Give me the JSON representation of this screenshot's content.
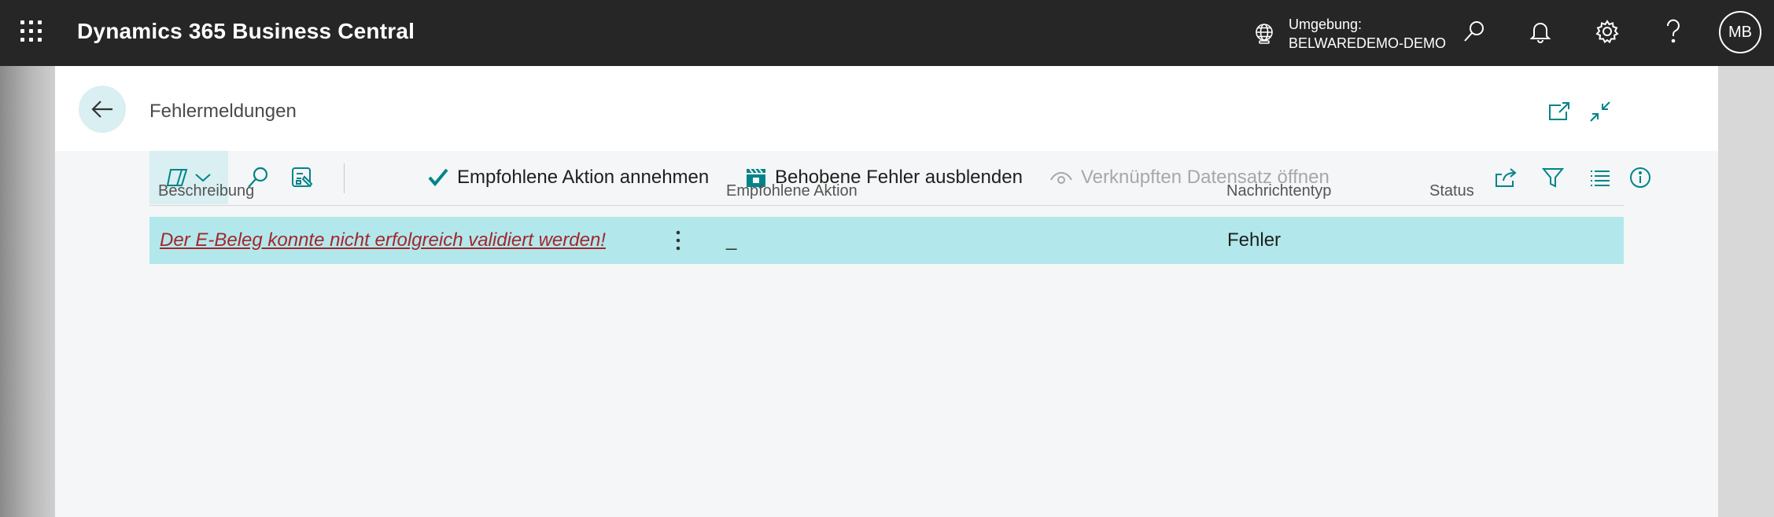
{
  "topbar": {
    "app_title": "Dynamics 365 Business Central",
    "environment_label": "Umgebung:",
    "environment_value": "BELWAREDEMO-DEMO",
    "user_initials": "MB",
    "icons": [
      "app-launcher-icon",
      "globe-icon",
      "search-icon",
      "bell-icon",
      "gear-icon",
      "help-icon"
    ]
  },
  "page": {
    "title": "Fehlermeldungen"
  },
  "actionbar": {
    "accept_label": "Empfohlene Aktion annehmen",
    "hide_fixed_label": "Behobene Fehler ausblenden",
    "open_record_label": "Verknüpften Datensatz öffnen"
  },
  "table": {
    "columns": [
      "Beschreibung",
      "Empfohlene Aktion",
      "Nachrichtentyp",
      "Status"
    ],
    "rows": [
      {
        "description": "Der E-Beleg konnte nicht erfolgreich validiert werden!",
        "recommended_action": "_",
        "message_type": "Fehler",
        "status": ""
      }
    ]
  },
  "colors": {
    "topbar_bg": "#262626",
    "accent": "#008489",
    "row_selected": "#b2e8eb",
    "link_error": "#a4262c"
  }
}
